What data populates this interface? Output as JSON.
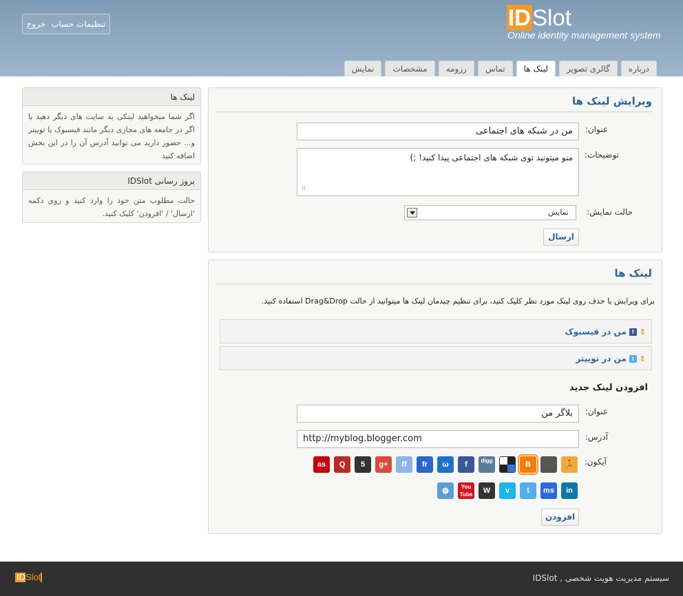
{
  "header": {
    "logo_id": "ID",
    "logo_slot": "Slot",
    "tagline": "Online identity management system",
    "account": {
      "settings_label": "تنظیمات حساب",
      "logout_label": "خروج"
    },
    "tabs": [
      {
        "label": "درباره",
        "active": false
      },
      {
        "label": "گالری تصویر",
        "active": false
      },
      {
        "label": "لینک ها",
        "active": true
      },
      {
        "label": "تماس",
        "active": false
      },
      {
        "label": "رزومه",
        "active": false
      },
      {
        "label": "مشخصات",
        "active": false
      },
      {
        "label": "نمایش",
        "active": false
      }
    ]
  },
  "edit_panel": {
    "title": "ویرایش لینک ها",
    "title_label": "عنوان:",
    "title_value": "من در شبکه های اجتماعی",
    "desc_label": "توضیحات:",
    "desc_value": "منو میتونید توی شبکه های اجتماعی پیدا کنید! ;)",
    "display_label": "حالت نمایش:",
    "display_value": "نمایش",
    "submit_label": "ارسال"
  },
  "links_panel": {
    "title": "لینک ها",
    "info": "برای ویرایش یا حذف روی لینک مورد نظر کلیک کنید، برای تنظیم چیدمان لینک ها میتوانید از حالت Drag&Drop استفاده کنید.",
    "items": [
      {
        "label": "من در فیسبوک",
        "icon": "facebook-icon"
      },
      {
        "label": "من در توییتر",
        "icon": "twitter-icon"
      }
    ],
    "add_heading": "افزودن لینک جدید",
    "add_title_label": "عنوان:",
    "add_title_value": "بلاگر من",
    "add_address_label": "آدرس:",
    "add_address_value": "http://myblog.blogger.com",
    "add_icon_label": "آیکون:",
    "add_button_label": "افزودن",
    "icons": [
      {
        "name": "runner-icon",
        "glyph": "🏃",
        "color": "#f2a93b"
      },
      {
        "name": "apple-icon",
        "glyph": "",
        "color": "#555555"
      },
      {
        "name": "blogger-icon",
        "glyph": "B",
        "color": "#f57d00"
      },
      {
        "name": "delicious-icon",
        "glyph": "",
        "color": "#ffffff"
      },
      {
        "name": "digg-icon",
        "glyph": "digg",
        "color": "#5b7c99"
      },
      {
        "name": "facebook-icon",
        "glyph": "f",
        "color": "#3b5998"
      },
      {
        "name": "fireeagle-icon",
        "glyph": "ω",
        "color": "#1f73c6"
      },
      {
        "name": "friendfeed-icon",
        "glyph": "fr",
        "color": "#2b67c7"
      },
      {
        "name": "friendfeed-alt-icon",
        "glyph": "ff",
        "color": "#8fb4e6"
      },
      {
        "name": "googleplus-icon",
        "glyph": "g+",
        "color": "#d84b3d"
      },
      {
        "name": "html5-icon",
        "glyph": "5",
        "color": "#333333"
      },
      {
        "name": "quora-icon",
        "glyph": "Q",
        "color": "#b92b27"
      },
      {
        "name": "lastfm-icon",
        "glyph": "as",
        "color": "#c3000d"
      },
      {
        "name": "linkedin-icon",
        "glyph": "in",
        "color": "#0e76a8"
      },
      {
        "name": "myspace-icon",
        "glyph": "ms",
        "color": "#2a6ad6"
      },
      {
        "name": "twitter-icon",
        "glyph": "t",
        "color": "#55acee"
      },
      {
        "name": "vimeo-icon",
        "glyph": "v",
        "color": "#1ab7ea"
      },
      {
        "name": "wordpress-icon",
        "glyph": "W",
        "color": "#333333"
      },
      {
        "name": "youtube-icon",
        "glyph": "You Tube",
        "color": "#cc181e"
      },
      {
        "name": "globe-icon",
        "glyph": "◍",
        "color": "#5a9fd4"
      }
    ]
  },
  "sidebar": {
    "links_box": {
      "title": "لینک ها",
      "body": "اگر شما میخواهید لینکی به سایت های دیگر دهید یا اگر در جامعه های مجازی دیگر مانند فیسبوک یا توییتر و... حضور دارید می توانید آدرس آن را در این بخش اضافه کنید"
    },
    "update_box": {
      "title": "بروز رسانی IDSlot",
      "body": "حالت مطلوب متن خود را وارد کنید و روی دکمه 'ارسال' / 'افزودن' کلیک کنید."
    }
  },
  "footer": {
    "logo_id": "ID",
    "logo_slot": "Slot",
    "text": "سیستم مدیریت هویت شخصی , IDSlot"
  }
}
